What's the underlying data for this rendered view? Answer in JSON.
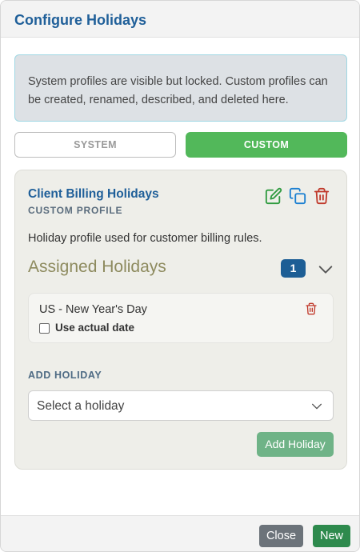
{
  "dialog": {
    "title": "Configure Holidays",
    "info_text": "System profiles are visible but locked. Custom profiles can be created, renamed, described, and deleted here."
  },
  "tabs": [
    {
      "label": "SYSTEM",
      "active": false
    },
    {
      "label": "CUSTOM",
      "active": true
    }
  ],
  "profile": {
    "name": "Client Billing Holidays",
    "type_label": "CUSTOM PROFILE",
    "description": "Holiday profile used for customer billing rules.",
    "actions": [
      "edit-icon",
      "copy-icon",
      "trash-icon"
    ]
  },
  "assigned": {
    "title": "Assigned Holidays",
    "count": "1",
    "items": [
      {
        "name": "US - New Year's Day",
        "checkbox_label": "Use actual date",
        "checked": false
      }
    ]
  },
  "add_holiday": {
    "label": "ADD HOLIDAY",
    "select_value": "Select a holiday",
    "button_label": "Add Holiday"
  },
  "footer": {
    "close_label": "Close",
    "new_label": "New"
  },
  "colors": {
    "title_blue": "#1f5f99",
    "custom_green": "#52b85a",
    "new_green": "#2e8a4d",
    "trash_red": "#c0392b",
    "badge_blue": "#1d5e95"
  }
}
